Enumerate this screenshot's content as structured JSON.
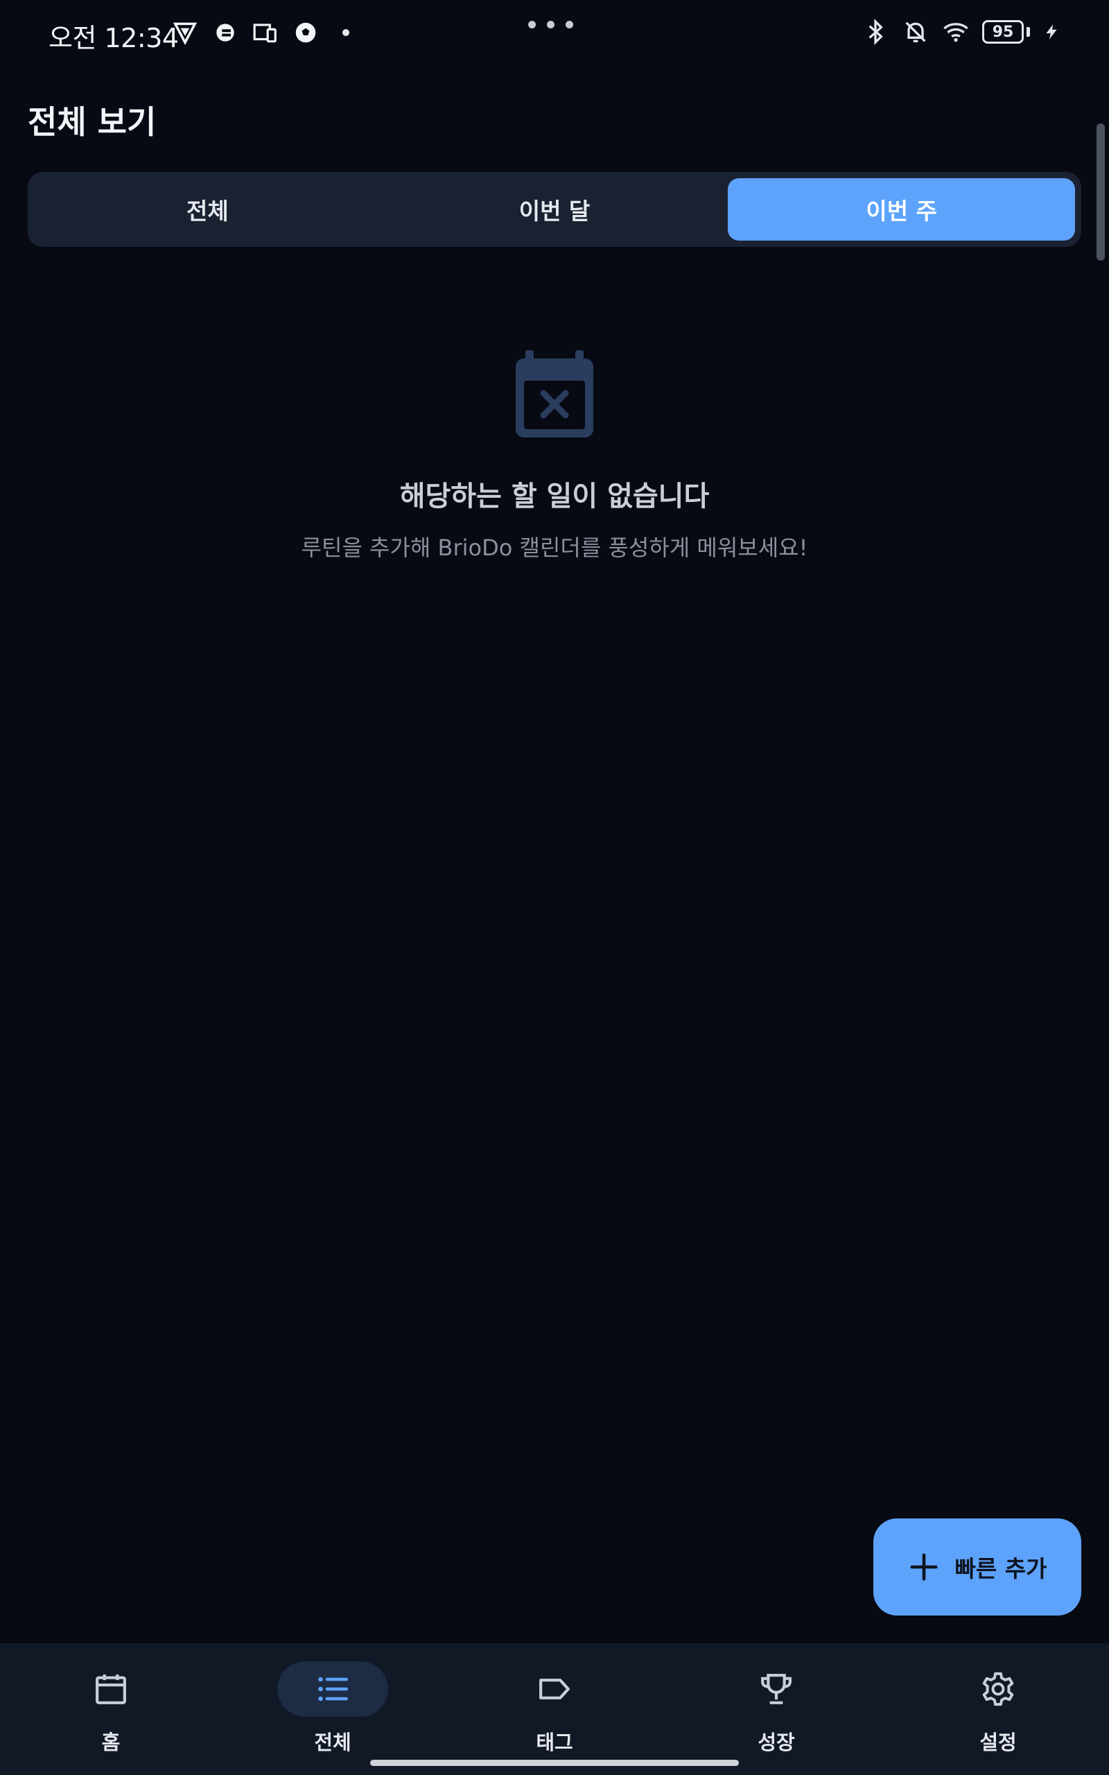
{
  "status_bar": {
    "time": "오전 12:34",
    "battery": "95"
  },
  "page": {
    "title": "전체 보기"
  },
  "filter_tabs": [
    {
      "label": "전체",
      "active": false
    },
    {
      "label": "이번 달",
      "active": false
    },
    {
      "label": "이번 주",
      "active": true
    }
  ],
  "empty_state": {
    "icon": "calendar-x-icon",
    "title": "해당하는 할 일이 없습니다",
    "subtitle": "루틴을 추가해 BrioDo 캘린더를 풍성하게 메워보세요!"
  },
  "fab": {
    "icon": "plus-icon",
    "label": "빠른 추가"
  },
  "bottom_nav": [
    {
      "label": "홈",
      "icon": "calendar-icon",
      "active": false
    },
    {
      "label": "전체",
      "icon": "list-icon",
      "active": true
    },
    {
      "label": "태그",
      "icon": "tag-icon",
      "active": false
    },
    {
      "label": "성장",
      "icon": "trophy-icon",
      "active": false
    },
    {
      "label": "설정",
      "icon": "gear-icon",
      "active": false
    }
  ],
  "colors": {
    "background": "#070a13",
    "accent": "#5ea3fb",
    "segment_bg": "#1a2232",
    "nav_bg": "#111826",
    "empty_icon": "#2a3d5e"
  }
}
